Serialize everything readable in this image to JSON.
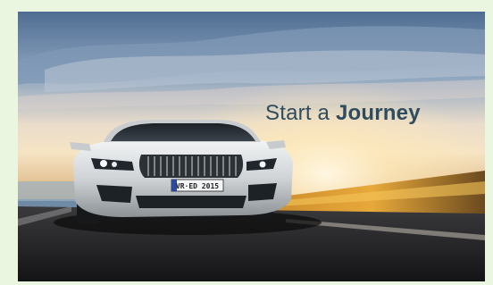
{
  "hero": {
    "headline_prefix": "Start a",
    "headline_emphasis": "Journey",
    "plate_text": "VR·ED 2015",
    "image_subject": "silver-sports-car-on-highway-at-sunset",
    "colors": {
      "page_background": "#eaf6df",
      "headline": "#2f4c5f",
      "sky_top": "#4f6d92",
      "sun_glow": "#fff4d6",
      "car_body": "#d9dde0"
    }
  }
}
